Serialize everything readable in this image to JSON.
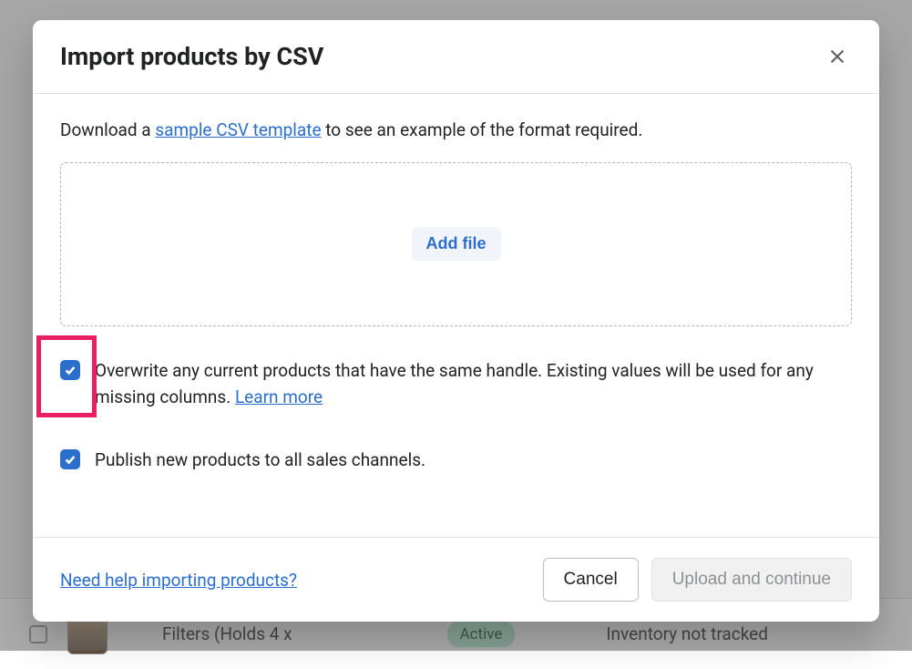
{
  "modal": {
    "title": "Import products by CSV",
    "intro_prefix": "Download a ",
    "intro_link": "sample CSV template",
    "intro_suffix": " to see an example of the format required.",
    "add_file_label": "Add file",
    "overwrite_label_part1": "Overwrite any current products that have the same handle. Existing values will be used for any missing columns. ",
    "overwrite_learn_more": "Learn more",
    "publish_label": "Publish new products to all sales channels.",
    "help_link": "Need help importing products?",
    "cancel_label": "Cancel",
    "upload_label": "Upload and continue"
  },
  "background": {
    "product_name": "Filters (Holds 4 x",
    "status_badge": "Active",
    "inventory_text": "Inventory not tracked"
  }
}
